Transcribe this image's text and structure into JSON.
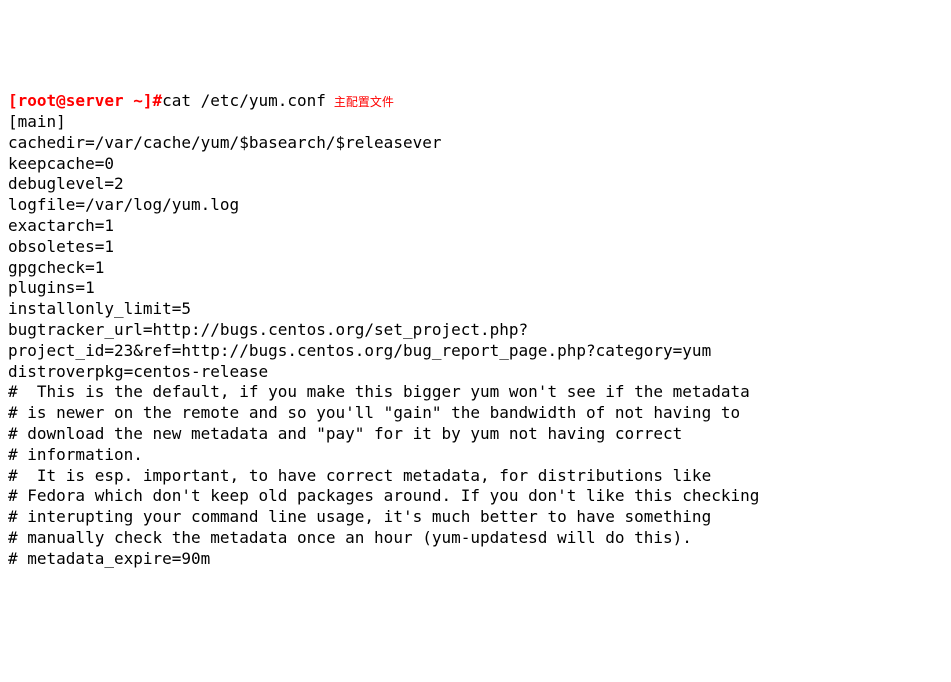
{
  "terminal": {
    "prompt": "[root@server ~]#",
    "command": "cat /etc/yum.conf",
    "annotation": "主配置文件",
    "output_lines": [
      "[main]",
      "cachedir=/var/cache/yum/$basearch/$releasever",
      "keepcache=0",
      "debuglevel=2",
      "logfile=/var/log/yum.log",
      "exactarch=1",
      "obsoletes=1",
      "gpgcheck=1",
      "plugins=1",
      "installonly_limit=5",
      "bugtracker_url=http://bugs.centos.org/set_project.php?project_id=23&ref=http://bugs.centos.org/bug_report_page.php?category=yum",
      "distroverpkg=centos-release",
      "",
      "",
      "#  This is the default, if you make this bigger yum won't see if the metadata",
      "# is newer on the remote and so you'll \"gain\" the bandwidth of not having to",
      "# download the new metadata and \"pay\" for it by yum not having correct",
      "# information.",
      "#  It is esp. important, to have correct metadata, for distributions like",
      "# Fedora which don't keep old packages around. If you don't like this checking",
      "# interupting your command line usage, it's much better to have something",
      "# manually check the metadata once an hour (yum-updatesd will do this).",
      "# metadata_expire=90m"
    ]
  }
}
